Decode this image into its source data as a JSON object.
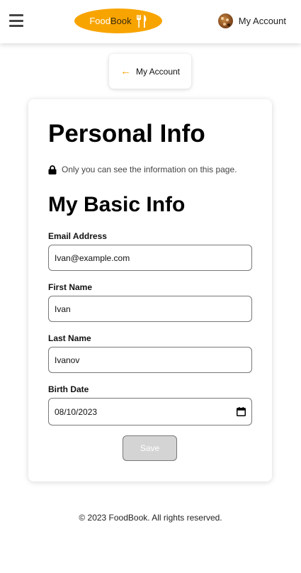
{
  "header": {
    "logo": {
      "part1": "Food",
      "part2": "Book",
      "icon": "fork-knife-icon"
    },
    "menu_icon": "hamburger-menu-icon",
    "account_label": "My Account",
    "avatar_icon": "cookie-avatar"
  },
  "back_button": {
    "label": "My Account",
    "icon": "arrow-left-icon"
  },
  "card": {
    "title": "Personal Info",
    "privacy_note": "Only you can see the information on this page.",
    "privacy_icon": "lock-icon",
    "section_title": "My Basic Info",
    "fields": [
      {
        "label": "Email Address",
        "value": "Ivan@example.com"
      },
      {
        "label": "First Name",
        "value": "Ivan"
      },
      {
        "label": "Last Name",
        "value": "Ivanov"
      },
      {
        "label": "Birth Date",
        "value": "08/10/2023"
      }
    ],
    "save_label": "Save"
  },
  "footer": {
    "text": "© 2023 FoodBook. All rights reserved."
  },
  "colors": {
    "accent": "#f8a400",
    "disabled_button": "#d4d4d4"
  }
}
